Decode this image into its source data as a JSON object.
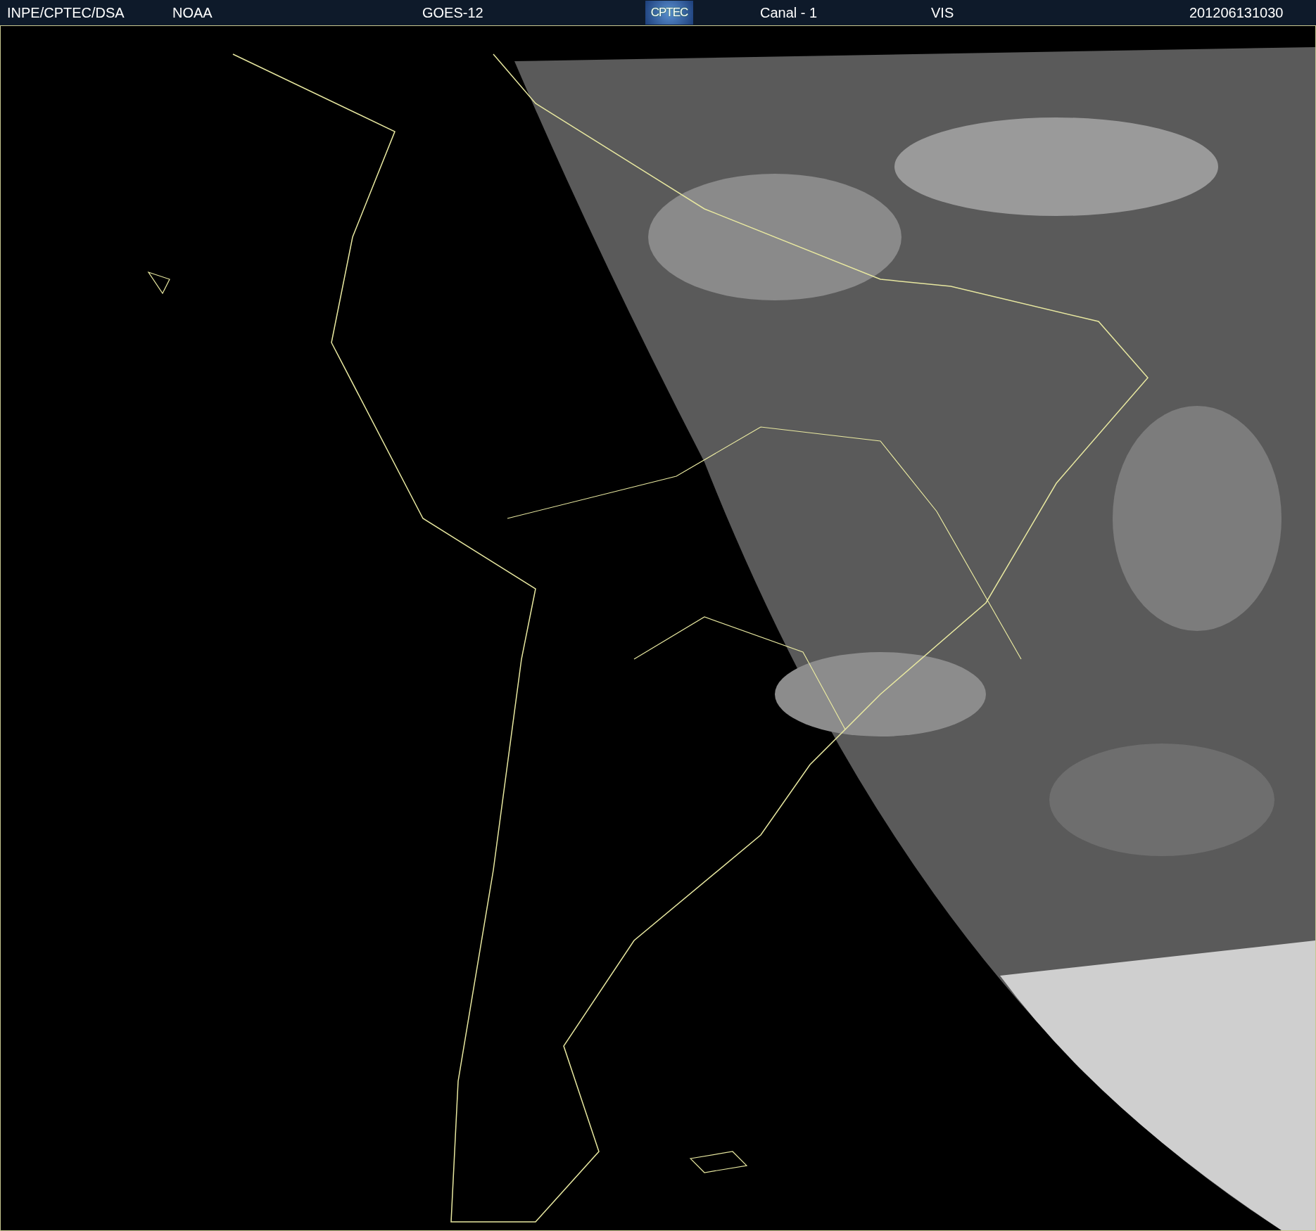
{
  "header": {
    "source": "INPE/CPTEC/DSA",
    "agency": "NOAA",
    "satellite": "GOES-12",
    "logo": "CPTEC",
    "channel": "Canal - 1",
    "band": "VIS",
    "timestamp": "201206131030"
  }
}
